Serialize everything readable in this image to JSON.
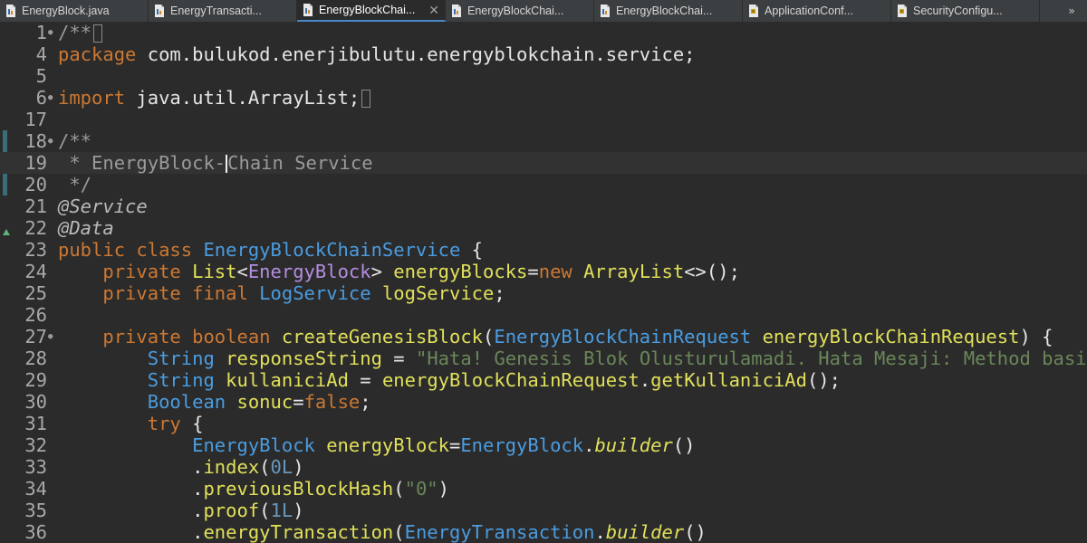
{
  "tabs": [
    {
      "label": "EnergyBlock.java",
      "icon": "java-file-icon",
      "active": false
    },
    {
      "label": "EnergyTransacti...",
      "icon": "java-file-icon",
      "active": false
    },
    {
      "label": "EnergyBlockChai...",
      "icon": "java-file-icon",
      "active": true
    },
    {
      "label": "EnergyBlockChai...",
      "icon": "java-file-icon",
      "active": false
    },
    {
      "label": "EnergyBlockChai...",
      "icon": "java-file-icon",
      "active": false
    },
    {
      "label": "ApplicationConf...",
      "icon": "java-config-icon",
      "active": false
    },
    {
      "label": "SecurityConfigu...",
      "icon": "java-config-icon",
      "active": false
    }
  ],
  "overflow_chevron": "»",
  "colors": {
    "background": "#2b2b2b",
    "keyword": "#cc7832",
    "type": "#4a9ce0",
    "method": "#e1e05a",
    "string": "#6a8759",
    "number": "#6897bb",
    "comment": "#9a9a9a",
    "accent": "#4a88c7"
  },
  "code_lines": [
    {
      "num": "1",
      "fold": "⊕",
      "tokens": [
        {
          "t": "/**",
          "c": "cm"
        },
        {
          "box": true
        }
      ]
    },
    {
      "num": "4",
      "tokens": [
        {
          "t": "package",
          "c": "kw"
        },
        {
          "t": " com.bulukod.enerjibulutu.energyblokchain.service;",
          "c": "pl"
        }
      ]
    },
    {
      "num": "5",
      "tokens": []
    },
    {
      "num": "6",
      "fold": "⊕",
      "tokens": [
        {
          "t": "import",
          "c": "kw"
        },
        {
          "t": " java.util.ArrayList;",
          "c": "pl"
        },
        {
          "box": true
        }
      ]
    },
    {
      "num": "17",
      "tokens": []
    },
    {
      "num": "18",
      "fold": "⊖",
      "changed": true,
      "tokens": [
        {
          "t": "/**",
          "c": "cm"
        }
      ]
    },
    {
      "num": "19",
      "current": true,
      "changed": true,
      "tokens": [
        {
          "t": " * EnergyBlock-",
          "c": "cm"
        },
        {
          "caret": true
        },
        {
          "t": "Chain Service",
          "c": "cm"
        }
      ]
    },
    {
      "num": "20",
      "changed": true,
      "tokens": [
        {
          "t": " */",
          "c": "cm"
        }
      ]
    },
    {
      "num": "21",
      "tokens": [
        {
          "t": "@Service",
          "c": "ann"
        }
      ]
    },
    {
      "num": "22",
      "marker": "override-marker-icon",
      "tokens": [
        {
          "t": "@Data",
          "c": "ann"
        }
      ]
    },
    {
      "num": "23",
      "tokens": [
        {
          "t": "public class ",
          "c": "kw"
        },
        {
          "t": "EnergyBlockChainService",
          "c": "ty"
        },
        {
          "t": " {",
          "c": "pl"
        }
      ]
    },
    {
      "num": "24",
      "tokens": [
        {
          "t": "    private ",
          "c": "kw"
        },
        {
          "t": "List",
          "c": "fn"
        },
        {
          "t": "<",
          "c": "pl"
        },
        {
          "t": "EnergyBlock",
          "c": "gn"
        },
        {
          "t": "> ",
          "c": "pl"
        },
        {
          "t": "energyBlocks",
          "c": "fn"
        },
        {
          "t": "=",
          "c": "pl"
        },
        {
          "t": "new ",
          "c": "kw"
        },
        {
          "t": "ArrayList",
          "c": "fn"
        },
        {
          "t": "<>();",
          "c": "pl"
        }
      ]
    },
    {
      "num": "25",
      "tokens": [
        {
          "t": "    private final ",
          "c": "kw"
        },
        {
          "t": "LogService",
          "c": "ty"
        },
        {
          "t": " ",
          "c": "pl"
        },
        {
          "t": "logService",
          "c": "fn"
        },
        {
          "t": ";",
          "c": "pl"
        }
      ]
    },
    {
      "num": "26",
      "tokens": []
    },
    {
      "num": "27",
      "fold": "⊖",
      "tokens": [
        {
          "t": "    private boolean ",
          "c": "kw"
        },
        {
          "t": "createGenesisBlock",
          "c": "fn"
        },
        {
          "t": "(",
          "c": "pl"
        },
        {
          "t": "EnergyBlockChainRequest",
          "c": "ty"
        },
        {
          "t": " ",
          "c": "pl"
        },
        {
          "t": "energyBlockChainRequest",
          "c": "fn"
        },
        {
          "t": ") {",
          "c": "pl"
        }
      ]
    },
    {
      "num": "28",
      "tokens": [
        {
          "t": "        ",
          "c": "pl"
        },
        {
          "t": "String",
          "c": "ty"
        },
        {
          "t": " ",
          "c": "pl"
        },
        {
          "t": "responseString",
          "c": "fn"
        },
        {
          "t": " = ",
          "c": "pl"
        },
        {
          "t": "\"Hata! Genesis Blok Olusturulamadi. Hata Mesaji: Method basinda",
          "c": "st"
        }
      ]
    },
    {
      "num": "29",
      "tokens": [
        {
          "t": "        ",
          "c": "pl"
        },
        {
          "t": "String",
          "c": "ty"
        },
        {
          "t": " ",
          "c": "pl"
        },
        {
          "t": "kullaniciAd",
          "c": "fn"
        },
        {
          "t": " = ",
          "c": "pl"
        },
        {
          "t": "energyBlockChainRequest",
          "c": "fn"
        },
        {
          "t": ".",
          "c": "pl"
        },
        {
          "t": "getKullaniciAd",
          "c": "fn"
        },
        {
          "t": "();",
          "c": "pl"
        }
      ]
    },
    {
      "num": "30",
      "tokens": [
        {
          "t": "        ",
          "c": "pl"
        },
        {
          "t": "Boolean",
          "c": "ty"
        },
        {
          "t": " ",
          "c": "pl"
        },
        {
          "t": "sonuc",
          "c": "fn"
        },
        {
          "t": "=",
          "c": "pl"
        },
        {
          "t": "false",
          "c": "kw"
        },
        {
          "t": ";",
          "c": "pl"
        }
      ]
    },
    {
      "num": "31",
      "tokens": [
        {
          "t": "        ",
          "c": "pl"
        },
        {
          "t": "try",
          "c": "kw"
        },
        {
          "t": " {",
          "c": "pl"
        }
      ]
    },
    {
      "num": "32",
      "tokens": [
        {
          "t": "            ",
          "c": "pl"
        },
        {
          "t": "EnergyBlock",
          "c": "ty"
        },
        {
          "t": " ",
          "c": "pl"
        },
        {
          "t": "energyBlock",
          "c": "fn"
        },
        {
          "t": "=",
          "c": "pl"
        },
        {
          "t": "EnergyBlock",
          "c": "ty"
        },
        {
          "t": ".",
          "c": "pl"
        },
        {
          "t": "builder",
          "c": "fi"
        },
        {
          "t": "()",
          "c": "pl"
        }
      ]
    },
    {
      "num": "33",
      "tokens": [
        {
          "t": "            .",
          "c": "pl"
        },
        {
          "t": "index",
          "c": "fn"
        },
        {
          "t": "(",
          "c": "pl"
        },
        {
          "t": "0L",
          "c": "nm"
        },
        {
          "t": ")",
          "c": "pl"
        }
      ]
    },
    {
      "num": "34",
      "tokens": [
        {
          "t": "            .",
          "c": "pl"
        },
        {
          "t": "previousBlockHash",
          "c": "fn"
        },
        {
          "t": "(",
          "c": "pl"
        },
        {
          "t": "\"0\"",
          "c": "st"
        },
        {
          "t": ")",
          "c": "pl"
        }
      ]
    },
    {
      "num": "35",
      "tokens": [
        {
          "t": "            .",
          "c": "pl"
        },
        {
          "t": "proof",
          "c": "fn"
        },
        {
          "t": "(",
          "c": "pl"
        },
        {
          "t": "1L",
          "c": "nm"
        },
        {
          "t": ")",
          "c": "pl"
        }
      ]
    },
    {
      "num": "36",
      "tokens": [
        {
          "t": "            .",
          "c": "pl"
        },
        {
          "t": "energyTransaction",
          "c": "fn"
        },
        {
          "t": "(",
          "c": "pl"
        },
        {
          "t": "EnergyTransaction",
          "c": "ty"
        },
        {
          "t": ".",
          "c": "pl"
        },
        {
          "t": "builder",
          "c": "fi"
        },
        {
          "t": "()",
          "c": "pl"
        }
      ]
    }
  ]
}
